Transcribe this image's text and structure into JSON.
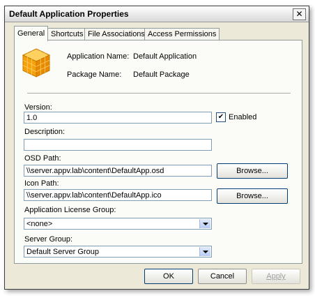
{
  "window": {
    "title": "Default Application Properties",
    "close_glyph": "✕"
  },
  "tabs": [
    {
      "label": "General"
    },
    {
      "label": "Shortcuts"
    },
    {
      "label": "File Associations"
    },
    {
      "label": "Access Permissions"
    }
  ],
  "general": {
    "app_name_label": "Application Name:",
    "app_name_value": "Default Application",
    "package_name_label": "Package Name:",
    "package_name_value": "Default Package",
    "version_label": "Version:",
    "version_value": "1.0",
    "enabled_label": "Enabled",
    "enabled_checked": true,
    "enabled_mark": "✔",
    "description_label": "Description:",
    "description_value": "",
    "osd_path_label": "OSD Path:",
    "osd_path_value": "\\\\server.appv.lab\\content\\DefaultApp.osd",
    "icon_path_label": "Icon Path:",
    "icon_path_value": "\\\\server.appv.lab\\content\\DefaultApp.ico",
    "browse_label": "Browse...",
    "license_group_label": "Application License Group:",
    "license_group_value": "<none>",
    "server_group_label": "Server Group:",
    "server_group_value": "Default Server Group"
  },
  "buttons": {
    "ok": "OK",
    "cancel": "Cancel",
    "apply": "Apply"
  },
  "icons": {
    "app_icon": "package-cube-icon"
  },
  "colors": {
    "title_bar": "#e8e8e8",
    "dialog_bg": "#ece9d8",
    "panel_bg": "#fbfbf7",
    "cube": "#f5a10a"
  }
}
